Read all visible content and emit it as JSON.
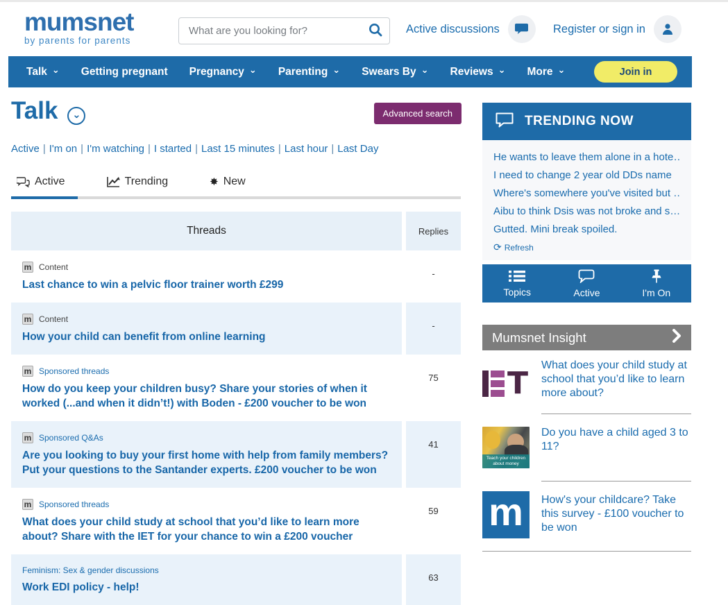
{
  "colors": {
    "brand_blue": "#1e6ba8",
    "link_blue": "#1a6cae",
    "title_blue": "#1766a8",
    "join_yellow": "#f1ec67",
    "advanced_purple": "#7c2c6f",
    "row_alt_blue": "#e9f2fa",
    "insight_grey": "#7d7d7d"
  },
  "header": {
    "logo_text": "mumsnet",
    "logo_tagline": "by parents for parents",
    "search_placeholder": "What are you looking for?",
    "active_discussions_label": "Active discussions",
    "register_label": "Register or sign in"
  },
  "nav": {
    "items": [
      {
        "label": "Talk",
        "has_dropdown": true
      },
      {
        "label": "Getting pregnant",
        "has_dropdown": false
      },
      {
        "label": "Pregnancy",
        "has_dropdown": true
      },
      {
        "label": "Parenting",
        "has_dropdown": true
      },
      {
        "label": "Swears By",
        "has_dropdown": true
      },
      {
        "label": "Reviews",
        "has_dropdown": true
      },
      {
        "label": "More",
        "has_dropdown": true
      }
    ],
    "join_label": "Join in",
    "chevron": "⌄"
  },
  "page": {
    "title": "Talk",
    "advanced_search_label": "Advanced search",
    "filters": [
      {
        "label": "Active"
      },
      {
        "label": "I'm on"
      },
      {
        "label": "I'm watching"
      },
      {
        "label": "I started"
      },
      {
        "label": "Last 15 minutes"
      },
      {
        "label": "Last hour"
      },
      {
        "label": "Last Day"
      }
    ],
    "filter_separator": "|",
    "tabs": [
      {
        "label": "Active",
        "icon": "chat-bubbles",
        "active": true
      },
      {
        "label": "Trending",
        "icon": "line-chart",
        "active": false
      },
      {
        "label": "New",
        "icon": "starburst",
        "active": false
      }
    ],
    "new_tab_glyph": "✸"
  },
  "table": {
    "headers": {
      "threads": "Threads",
      "replies": "Replies"
    },
    "rows": [
      {
        "badge": "m",
        "category": "Content",
        "title": "Last chance to win a pelvic floor trainer worth £299",
        "replies": "-"
      },
      {
        "badge": "m",
        "category": "Content",
        "title": "How your child can benefit from online learning",
        "replies": "-"
      },
      {
        "badge": "m",
        "category": "Sponsored threads",
        "title": "How do you keep your children busy? Share your stories of when it worked (...and when it didn’t!) with Boden - £200 voucher to be won",
        "replies": "75"
      },
      {
        "badge": "m",
        "category": "Sponsored Q&As",
        "title": "Are you looking to buy your first home with help from family members? Put your questions to the Santander experts. £200 voucher to be won",
        "replies": "41"
      },
      {
        "badge": "m",
        "category": "Sponsored threads",
        "title": "What does your child study at school that you’d like to learn more about? Share with the IET for your chance to win a £200 voucher",
        "replies": "59"
      },
      {
        "badge": "",
        "category": "Feminism: Sex & gender discussions",
        "title": "Work EDI policy - help!",
        "replies": "63"
      }
    ]
  },
  "trending": {
    "title": "TRENDING NOW",
    "items": [
      {
        "label": "He wants to leave them alone in a hote…"
      },
      {
        "label": "I need to change 2 year old DDs name"
      },
      {
        "label": "Where's somewhere you've visited but …"
      },
      {
        "label": "Aibu to think Dsis was not broke and s…"
      },
      {
        "label": "Gutted. Mini break spoiled."
      }
    ],
    "refresh_label": "Refresh",
    "refresh_glyph": "⟳"
  },
  "quickbar": {
    "items": [
      {
        "label": "Topics",
        "icon": "list"
      },
      {
        "label": "Active",
        "icon": "chat-bubble"
      },
      {
        "label": "I'm On",
        "icon": "pin"
      }
    ]
  },
  "insight": {
    "title": "Mumsnet Insight",
    "items": [
      {
        "thumb": "iet-logo",
        "text": "What does your child study at school that you’d like to learn more about?"
      },
      {
        "thumb": "children-money-photo",
        "caption": "Teach your children about money",
        "text": "Do you have a child aged 3 to 11?"
      },
      {
        "thumb": "mumsnet-logo",
        "logo_letter": "m",
        "text": "How's your childcare? Take this survey - £100 voucher to be won"
      }
    ]
  }
}
